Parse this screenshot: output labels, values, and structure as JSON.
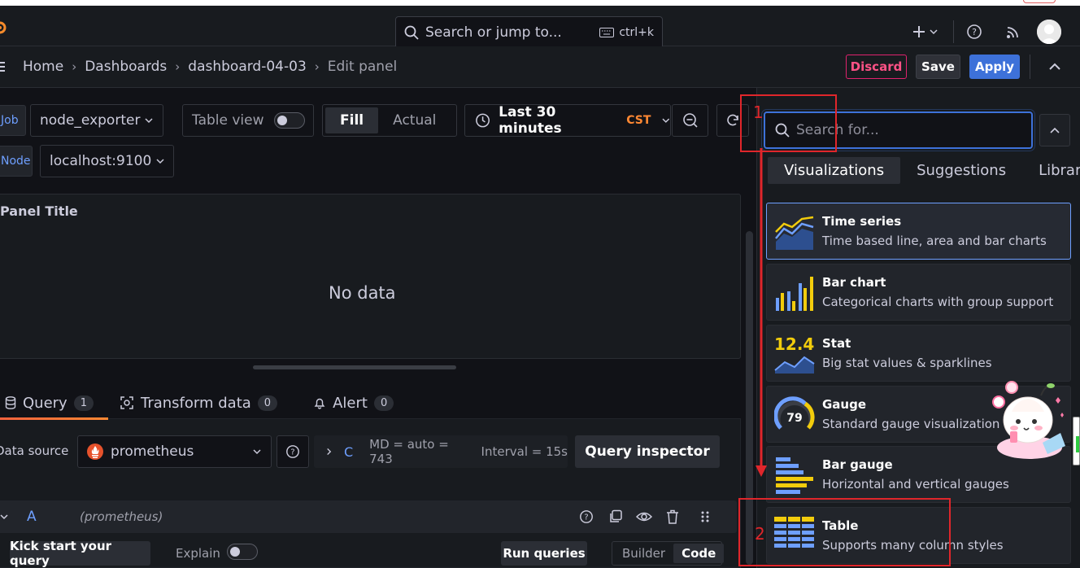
{
  "header": {
    "search_placeholder": "Search or jump to...",
    "search_shortcut": "ctrl+k"
  },
  "breadcrumb": {
    "items": [
      "Home",
      "Dashboards",
      "dashboard-04-03"
    ],
    "current": "Edit panel"
  },
  "actions": {
    "discard": "Discard",
    "save": "Save",
    "apply": "Apply"
  },
  "variables": {
    "job_label": "Job",
    "job_value": "node_exporter",
    "node_label": "Node",
    "node_value": "localhost:9100"
  },
  "toolbar": {
    "table_view": "Table view",
    "fill": "Fill",
    "actual": "Actual",
    "time_range": "Last 30 minutes",
    "timezone": "CST"
  },
  "panel": {
    "title": "Panel Title",
    "no_data": "No data"
  },
  "tabs": [
    {
      "label": "Query",
      "count": "1"
    },
    {
      "label": "Transform data",
      "count": "0"
    },
    {
      "label": "Alert",
      "count": "0"
    }
  ],
  "query": {
    "datasource_label": "Data source",
    "datasource": "prometheus",
    "options_letter": "C",
    "md": "MD = auto = 743",
    "interval": "Interval = 15s",
    "inspector": "Query inspector",
    "ref_id": "A",
    "ref_source": "(prometheus)",
    "kick_start": "Kick start your query",
    "explain": "Explain",
    "run_queries": "Run queries",
    "builder": "Builder",
    "code": "Code"
  },
  "viz_picker": {
    "search_placeholder": "Search for...",
    "tabs": [
      "Visualizations",
      "Suggestions",
      "Library"
    ],
    "items": [
      {
        "title": "Time series",
        "desc": "Time based line, area and bar charts"
      },
      {
        "title": "Bar chart",
        "desc": "Categorical charts with group support"
      },
      {
        "title": "Stat",
        "desc": "Big stat values & sparklines",
        "icon_value": "12.4"
      },
      {
        "title": "Gauge",
        "desc": "Standard gauge visualization",
        "icon_value": "79"
      },
      {
        "title": "Bar gauge",
        "desc": "Horizontal and vertical gauges"
      },
      {
        "title": "Table",
        "desc": "Supports many column styles"
      }
    ]
  },
  "annotations": {
    "label_1": "1",
    "label_2": "2"
  },
  "colors": {
    "accent_blue": "#3d71d9",
    "discard_pink": "#ff5286",
    "annotation_red": "#e0262b",
    "orange": "#ff8833"
  }
}
